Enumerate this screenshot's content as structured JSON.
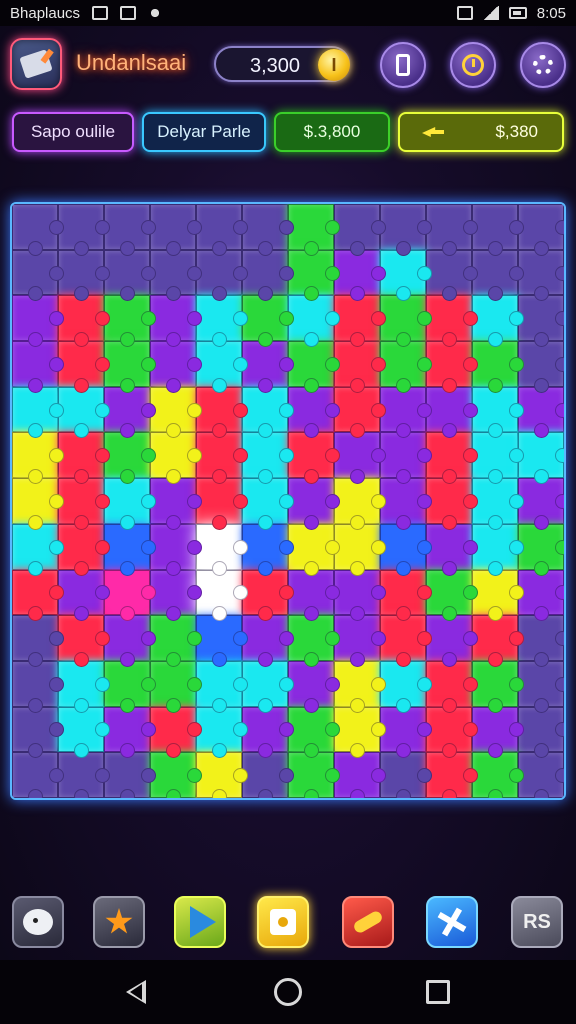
{
  "status_bar": {
    "carrier_text": "Bhaplaucs",
    "time": "8:05"
  },
  "header": {
    "title": "Undanlsaai",
    "coins": "3,300",
    "coin_symbol": "I"
  },
  "tabs": [
    {
      "label": "Sapo oulile"
    },
    {
      "label": "Delyar Parle"
    },
    {
      "label": "$.3,800"
    },
    {
      "label": "$,380"
    }
  ],
  "toolbar": {
    "last_label": "RS"
  },
  "colors": {
    "accent_purple": "#c85aff",
    "accent_cyan": "#3ac8ff",
    "accent_green": "#3acf2a",
    "accent_yellow": "#e8ff3a",
    "board_border": "#5ab8ff"
  },
  "board": {
    "columns": 12,
    "rows": 13,
    "pieces": [
      "purple",
      "purple",
      "purple",
      "purple",
      "purple",
      "purple",
      "green",
      "purple",
      "purple",
      "purple",
      "purple",
      "purple",
      "purple",
      "purple",
      "purple",
      "purple",
      "purple",
      "purple",
      "green",
      "violet",
      "cyan",
      "purple",
      "purple",
      "purple",
      "violet",
      "red",
      "green",
      "violet",
      "cyan",
      "green",
      "cyan",
      "red",
      "green",
      "red",
      "cyan",
      "purple",
      "violet",
      "red",
      "green",
      "violet",
      "cyan",
      "violet",
      "green",
      "red",
      "green",
      "red",
      "green",
      "purple",
      "cyan",
      "cyan",
      "violet",
      "yellow",
      "red",
      "cyan",
      "violet",
      "red",
      "violet",
      "violet",
      "cyan",
      "violet",
      "yellow",
      "red",
      "green",
      "yellow",
      "red",
      "cyan",
      "red",
      "violet",
      "violet",
      "red",
      "cyan",
      "cyan",
      "yellow",
      "red",
      "cyan",
      "violet",
      "red",
      "cyan",
      "violet",
      "yellow",
      "violet",
      "red",
      "cyan",
      "violet",
      "cyan",
      "red",
      "blue",
      "violet",
      "white",
      "blue",
      "yellow",
      "yellow",
      "blue",
      "violet",
      "cyan",
      "green",
      "red",
      "violet",
      "pink",
      "violet",
      "white",
      "red",
      "violet",
      "violet",
      "red",
      "green",
      "yellow",
      "violet",
      "purple",
      "red",
      "violet",
      "green",
      "blue",
      "violet",
      "green",
      "violet",
      "red",
      "violet",
      "red",
      "purple",
      "purple",
      "cyan",
      "green",
      "green",
      "cyan",
      "cyan",
      "violet",
      "yellow",
      "cyan",
      "red",
      "green",
      "purple",
      "purple",
      "cyan",
      "violet",
      "red",
      "cyan",
      "violet",
      "green",
      "yellow",
      "violet",
      "red",
      "violet",
      "purple",
      "purple",
      "purple",
      "purple",
      "green",
      "yellow",
      "purple",
      "green",
      "violet",
      "purple",
      "red",
      "green",
      "purple"
    ]
  }
}
